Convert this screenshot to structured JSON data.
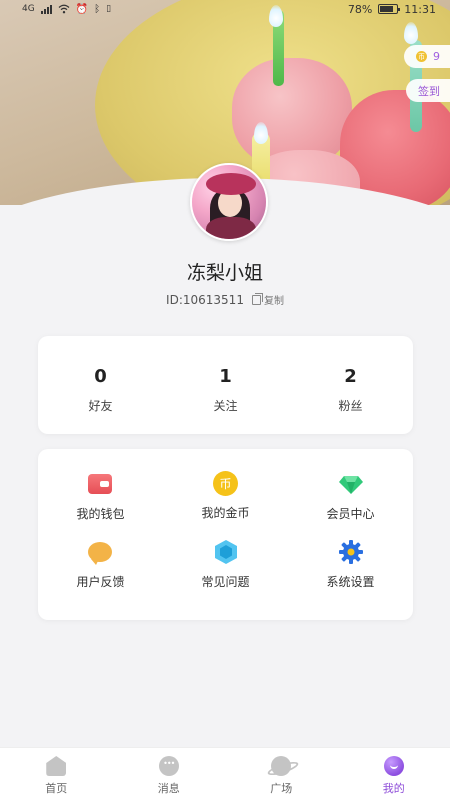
{
  "status_bar": {
    "network": "4G",
    "battery": "78%",
    "time": "11:31"
  },
  "header": {
    "coins": {
      "count": "9",
      "icon": "coin-icon"
    },
    "signin_label": "签到"
  },
  "profile": {
    "nickname": "冻梨小姐",
    "id_text": "ID:10613511",
    "copy_label": "复制"
  },
  "stats": [
    {
      "value": "0",
      "label": "好友"
    },
    {
      "value": "1",
      "label": "关注"
    },
    {
      "value": "2",
      "label": "粉丝"
    }
  ],
  "menu": [
    {
      "label": "我的钱包",
      "icon": "wallet-icon"
    },
    {
      "label": "我的金币",
      "icon": "coin-icon",
      "glyph": "币"
    },
    {
      "label": "会员中心",
      "icon": "diamond-icon"
    },
    {
      "label": "用户反馈",
      "icon": "feedback-icon"
    },
    {
      "label": "常见问题",
      "icon": "hexagon-icon"
    },
    {
      "label": "系统设置",
      "icon": "gear-icon"
    }
  ],
  "tabbar": [
    {
      "label": "首页",
      "icon": "home-icon"
    },
    {
      "label": "消息",
      "icon": "message-icon"
    },
    {
      "label": "广场",
      "icon": "planet-icon"
    },
    {
      "label": "我的",
      "icon": "profile-icon",
      "active": true
    }
  ],
  "colors": {
    "accent": "#8f4fd9",
    "coin": "#f5c219",
    "wallet": "#e64e55",
    "diamond": "#31c97a",
    "gear": "#2a6fe0",
    "feedback": "#f3b347"
  }
}
